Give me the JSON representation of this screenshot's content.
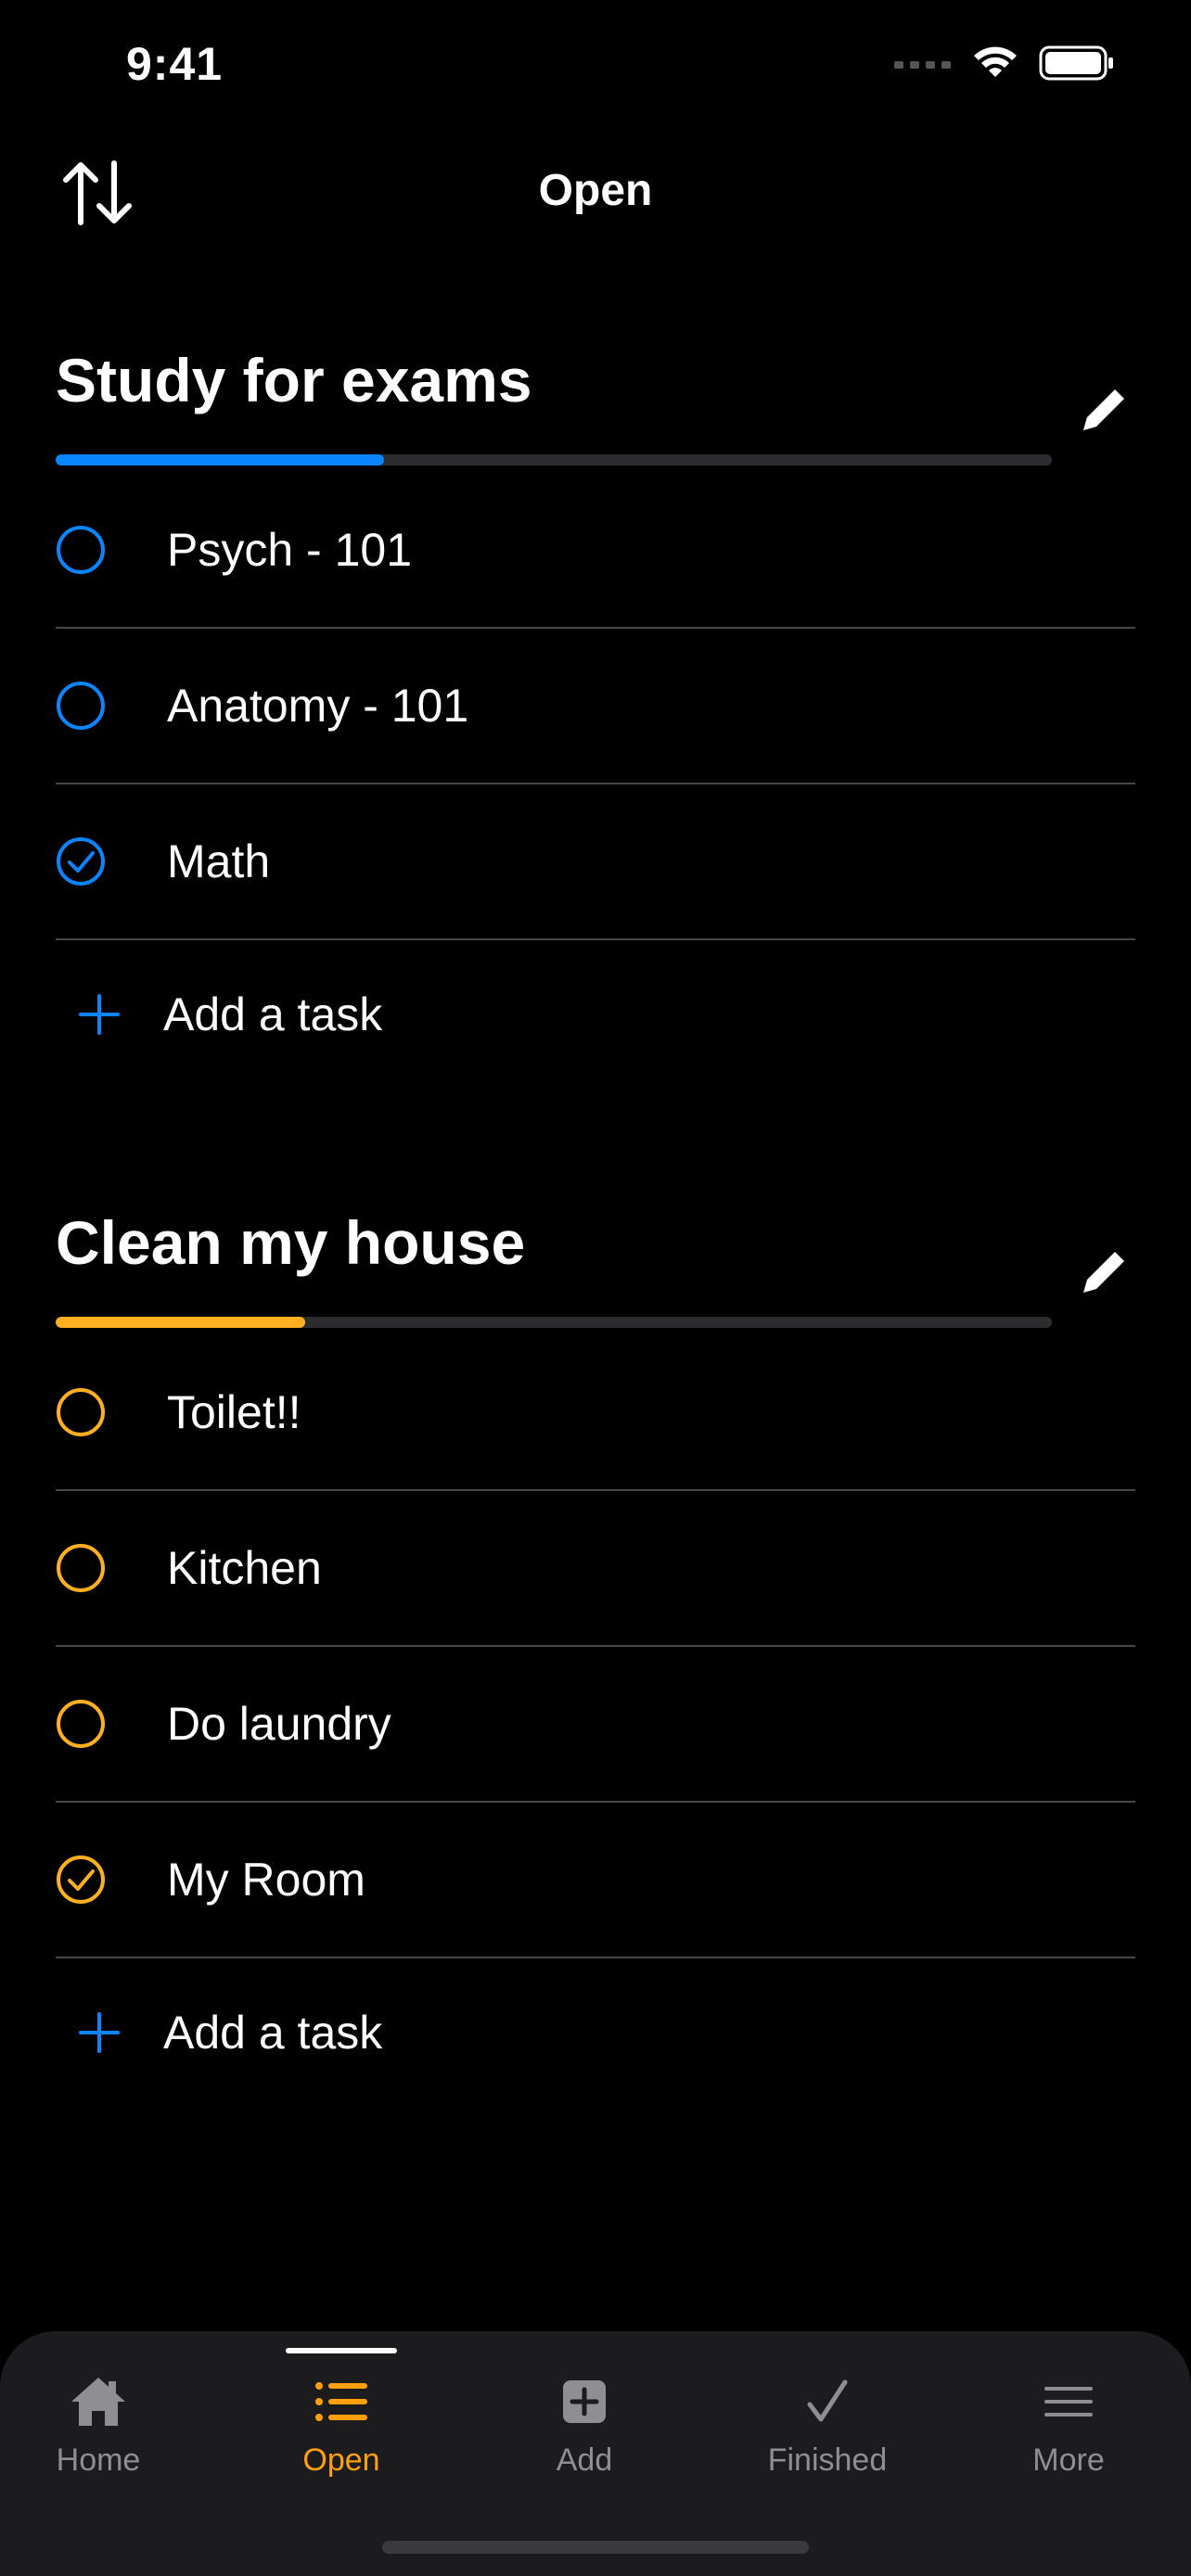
{
  "status_bar": {
    "time": "9:41"
  },
  "nav": {
    "title": "Open"
  },
  "lists": [
    {
      "title": "Study for exams",
      "color": "#0a84ff",
      "progress": 0.33,
      "tasks": [
        {
          "label": "Psych - 101",
          "done": false
        },
        {
          "label": "Anatomy - 101",
          "done": false
        },
        {
          "label": "Math",
          "done": true
        }
      ],
      "add_label": "Add a task"
    },
    {
      "title": "Clean my house",
      "color": "#ffb020",
      "progress": 0.25,
      "tasks": [
        {
          "label": "Toilet!!",
          "done": false
        },
        {
          "label": "Kitchen",
          "done": false
        },
        {
          "label": "Do laundry",
          "done": false
        },
        {
          "label": "My Room",
          "done": true
        }
      ],
      "add_label": "Add a task"
    }
  ],
  "tab_bar": {
    "active": "open",
    "tabs": [
      {
        "id": "home",
        "label": "Home",
        "icon": "house-icon"
      },
      {
        "id": "open",
        "label": "Open",
        "icon": "list-icon"
      },
      {
        "id": "add",
        "label": "Add",
        "icon": "plus-square-icon"
      },
      {
        "id": "finished",
        "label": "Finished",
        "icon": "checkmark-icon"
      },
      {
        "id": "more",
        "label": "More",
        "icon": "menu-icon"
      }
    ]
  },
  "colors": {
    "accent_blue": "#0a84ff",
    "accent_orange": "#ff9f0a",
    "add_plus": "#0a84ff"
  }
}
